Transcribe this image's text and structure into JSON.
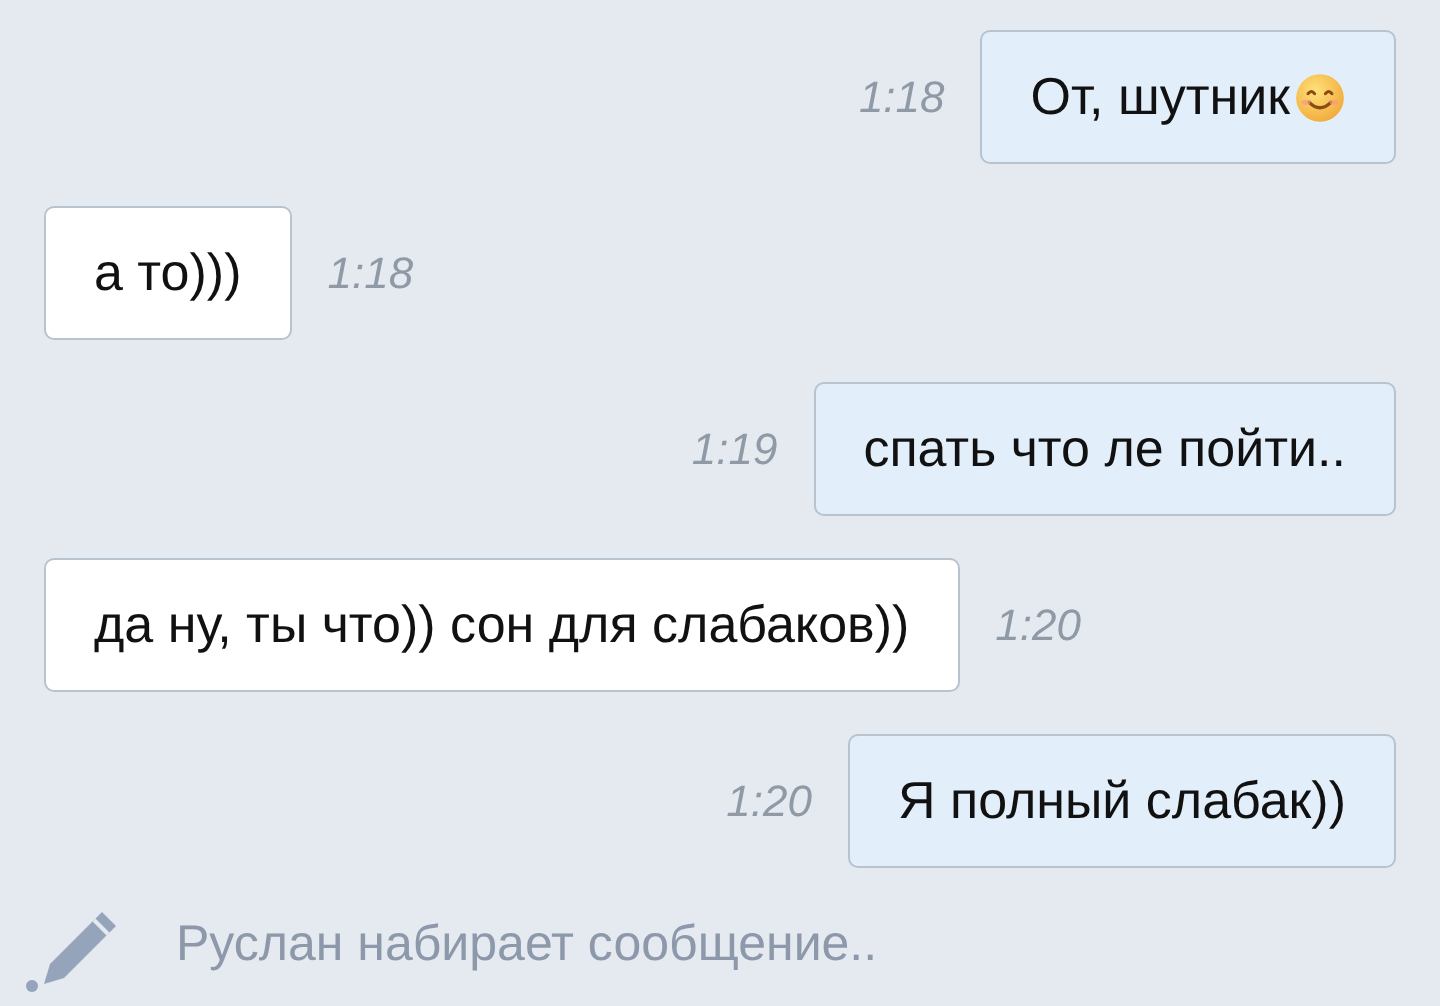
{
  "messages": [
    {
      "text": "От, шутник",
      "time": "1:18",
      "kind": "outgoing",
      "emoji": true
    },
    {
      "text": "а то)))",
      "time": "1:18",
      "kind": "incoming",
      "emoji": false
    },
    {
      "text": "спать что ле пойти..",
      "time": "1:19",
      "kind": "outgoing",
      "emoji": false
    },
    {
      "text": "да ну, ты что)) сон для слабаков))",
      "time": "1:20",
      "kind": "incoming",
      "emoji": false
    },
    {
      "text": "Я полный слабак))",
      "time": "1:20",
      "kind": "outgoing",
      "emoji": false
    }
  ],
  "typing_status": "Руслан набирает сообщение.."
}
